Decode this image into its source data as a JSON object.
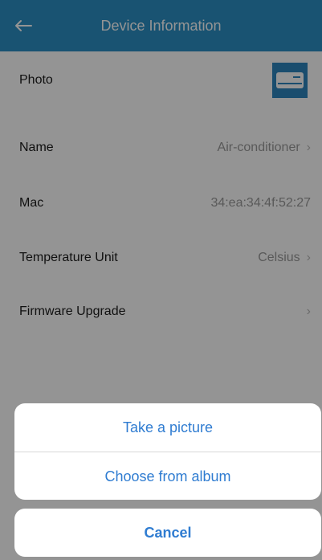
{
  "header": {
    "title": "Device Information",
    "back_icon": "arrow-left-icon"
  },
  "rows": [
    {
      "label": "Photo",
      "value": "",
      "thumb_icon": "air-conditioner-icon"
    },
    {
      "label": "Name",
      "value": "Air-conditioner"
    },
    {
      "label": "Mac",
      "value": "34:ea:34:4f:52:27"
    },
    {
      "label": "Temperature Unit",
      "value": "Celsius"
    },
    {
      "label": "Firmware Upgrade",
      "value": ""
    }
  ],
  "action_sheet": {
    "options": [
      "Take a picture",
      "Choose from album"
    ],
    "cancel": "Cancel"
  },
  "colors": {
    "header_bg": "#2b8fc4",
    "action_text": "#2f7cd1",
    "overlay": "rgba(0,0,0,0.42)"
  }
}
